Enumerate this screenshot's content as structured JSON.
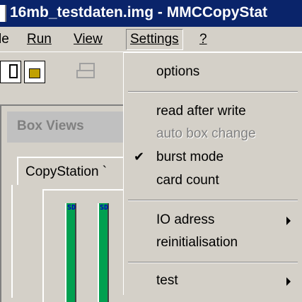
{
  "window": {
    "title": "16mb_testdaten.img - MMCCopyStat"
  },
  "menubar": {
    "items": [
      {
        "label": "le"
      },
      {
        "label": "Run"
      },
      {
        "label": "View"
      },
      {
        "label": "Settings"
      },
      {
        "label": "?"
      }
    ]
  },
  "panel": {
    "title": "Box Views",
    "tab_label": "CopyStation `",
    "slot_label": "SD"
  },
  "settings_menu": {
    "items": [
      {
        "label": "options",
        "enabled": true
      },
      {
        "label": "read after write",
        "enabled": true
      },
      {
        "label": "auto box change",
        "enabled": false
      },
      {
        "label": "burst mode",
        "enabled": true,
        "checked": true
      },
      {
        "label": "card count",
        "enabled": true
      },
      {
        "label": "IO adress",
        "enabled": true,
        "submenu": true
      },
      {
        "label": "reinitialisation",
        "enabled": true
      },
      {
        "label": "test",
        "enabled": true,
        "submenu": true
      }
    ]
  },
  "colors": {
    "titlebar": "#0a246a",
    "face": "#d4d0c8",
    "slot": "#00a050"
  },
  "icons": [
    "app-icon",
    "new-document-icon",
    "open-folder-icon",
    "print-icon",
    "checkmark-icon",
    "submenu-arrow-icon"
  ]
}
